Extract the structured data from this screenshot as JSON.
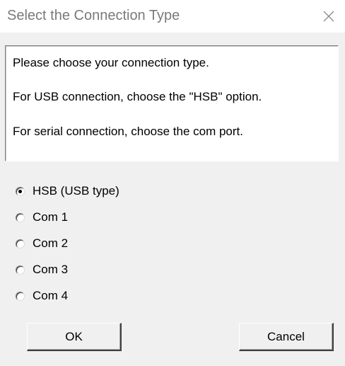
{
  "window": {
    "title": "Select the Connection Type",
    "close_icon": "close-icon"
  },
  "info": {
    "line1": "Please choose your connection type.",
    "line2": "For USB connection, choose the \"HSB\" option.",
    "line3": "For serial connection, choose the com port."
  },
  "connection_options": [
    {
      "label": "HSB (USB type)",
      "checked": true
    },
    {
      "label": "Com 1",
      "checked": false
    },
    {
      "label": "Com 2",
      "checked": false
    },
    {
      "label": "Com 3",
      "checked": false
    },
    {
      "label": "Com 4",
      "checked": false
    }
  ],
  "buttons": {
    "ok": "OK",
    "cancel": "Cancel"
  }
}
